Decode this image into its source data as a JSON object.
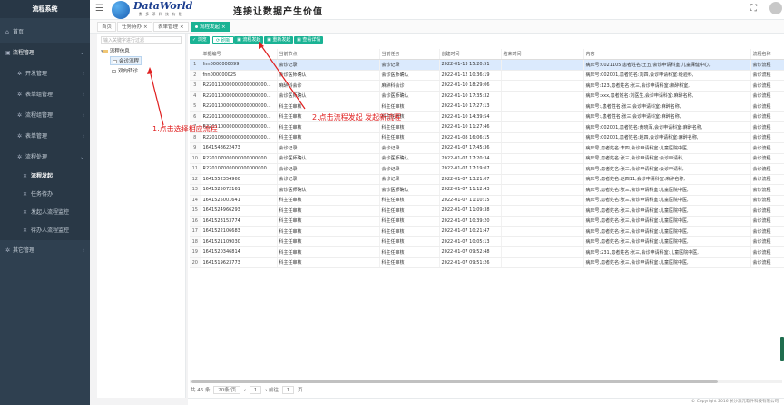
{
  "app": {
    "title": "流程系统"
  },
  "sidebar": {
    "items": [
      {
        "label": "首页",
        "icon": "home-icon"
      },
      {
        "label": "流程管理",
        "icon": "cube-icon",
        "expanded": true
      }
    ],
    "subitems": [
      {
        "label": "开发管理"
      },
      {
        "label": "表单组管理"
      },
      {
        "label": "流程组管理"
      },
      {
        "label": "表单管理"
      },
      {
        "label": "流程处理",
        "expanded": true
      }
    ],
    "leafs": [
      {
        "label": "流程发起",
        "active": true
      },
      {
        "label": "任务待办"
      },
      {
        "label": "发起人流程监控"
      },
      {
        "label": "待办人流程监控"
      }
    ],
    "other": {
      "label": "其它管理"
    }
  },
  "header": {
    "logo_text": "DataWorld",
    "logo_sub": "数 多 浮 科 技 有 限",
    "slogan": "连接让数据产生价值"
  },
  "tabs": [
    {
      "label": "首页",
      "active": false
    },
    {
      "label": "任务待办",
      "active": false,
      "close": "×"
    },
    {
      "label": "表单管理",
      "active": false,
      "close": "×"
    },
    {
      "label": "流程发起",
      "active": true,
      "close": "×"
    }
  ],
  "tree": {
    "search_placeholder": "输入关键字进行过滤",
    "root": "流程信息",
    "children": [
      "会诊流程",
      "双向转诊"
    ]
  },
  "toolbar": {
    "buttons": [
      "浏览",
      "刷新",
      "流程发起",
      "重新发起",
      "查看详情"
    ]
  },
  "table": {
    "columns": [
      "",
      "单据编号",
      "当前节点",
      "当前任务",
      "创建时间",
      "结束时间",
      "内容",
      "流程名称"
    ],
    "rows": [
      [
        "1",
        "fnn0000000099",
        "会诊记录",
        "会诊记录",
        "2022-01-13 15:20:51",
        "",
        "病床号:0021105,患者姓名:王五,会诊申请科室:儿童保健中心,",
        "会诊流程"
      ],
      [
        "2",
        "fnn000000025",
        "会诊医师确认",
        "会诊医师确认",
        "2022-01-12 10:36:19",
        "",
        "病床号:002001,患者姓名:刘四,会诊申请科室:经验科,",
        "会诊流程"
      ],
      [
        "3",
        "R220110000000000000000...",
        "麻醉科会诊",
        "麻醉科会诊",
        "2022-01-10 18:29:06",
        "",
        "病床号:123,患者姓名:张三,会诊申请科室:麻醉科室,",
        "会诊流程"
      ],
      [
        "4",
        "R220110000000000000000...",
        "会诊医师确认",
        "会诊医师确认",
        "2022-01-10 17:35:32",
        "",
        "病床号:xxx,患者姓名:刘医生,会诊申请科室:麻醉名称,",
        "会诊流程"
      ],
      [
        "5",
        "R220110000000000000000...",
        "科主任审核",
        "科主任审核",
        "2022-01-10 17:27:13",
        "",
        "病床号:,患者姓名:张三,会诊申请科室:麻醉名称,",
        "会诊流程"
      ],
      [
        "6",
        "R220110000000000000000...",
        "科主任审核",
        "科主任审核",
        "2022-01-10 14:39:54",
        "",
        "病床号:,患者姓名:张三,会诊申请科室:麻醉名称,",
        "会诊流程"
      ],
      [
        "7",
        "R220110000000000000000...",
        "科主任审核",
        "科主任审核",
        "2022-01-10 11:27:46",
        "",
        "病床号:002001,患者姓名:黄晓军,会诊申请科室:麻醉名称,",
        "会诊流程"
      ],
      [
        "8",
        "R220108000000000000000...",
        "科主任审核",
        "科主任审核",
        "2022-01-08 16:06:15",
        "",
        "病床号:002001,患者姓名:赵四,会诊申请科室:麻醉名称,",
        "会诊流程"
      ],
      [
        "9",
        "1641548622473",
        "会诊记录",
        "会诊记录",
        "2022-01-07 17:45:36",
        "",
        "病床号,患者姓名:李四,会诊申请科室:儿童医院中医,",
        "会诊流程"
      ],
      [
        "10",
        "R220107000000000000000...",
        "会诊医师确认",
        "会诊医师确认",
        "2022-01-07 17:20:34",
        "",
        "病床号,患者姓名:张三,会诊申请科室:会诊申请科,",
        "会诊流程"
      ],
      [
        "11",
        "R220107000000000000000...",
        "会诊记录",
        "会诊记录",
        "2022-01-07 17:19:07",
        "",
        "病床号,患者姓名:张三,会诊申请科室:会诊申请科,",
        "会诊流程"
      ],
      [
        "12",
        "1641552354960",
        "会诊记录",
        "会诊记录",
        "2022-01-07 13:21:07",
        "",
        "病床号,患者姓名:赵四11,会诊申请科室:麻醉名称,",
        "会诊流程"
      ],
      [
        "13",
        "1641525072161",
        "会诊医师确认",
        "会诊医师确认",
        "2022-01-07 11:12:43",
        "",
        "病床号,患者姓名:张三,会诊申请科室:儿童医院中医,",
        "会诊流程"
      ],
      [
        "14",
        "1641525001641",
        "科主任审核",
        "科主任审核",
        "2022-01-07 11:10:15",
        "",
        "病床号,患者姓名:张三,会诊申请科室:儿童医院中医,",
        "会诊流程"
      ],
      [
        "15",
        "1641524966293",
        "科主任审核",
        "科主任审核",
        "2022-01-07 11:09:38",
        "",
        "病床号,患者姓名:张三,会诊申请科室:儿童医院中医,",
        "会诊流程"
      ],
      [
        "16",
        "1641523153774",
        "科主任审核",
        "科主任审核",
        "2022-01-07 10:39:20",
        "",
        "病床号,患者姓名:张三,会诊申请科室:儿童医院中医,",
        "会诊流程"
      ],
      [
        "17",
        "1641522106683",
        "科主任审核",
        "科主任审核",
        "2022-01-07 10:21:47",
        "",
        "病床号,患者姓名:张三,会诊申请科室:儿童医院中医,",
        "会诊流程"
      ],
      [
        "18",
        "1641521109030",
        "科主任审核",
        "科主任审核",
        "2022-01-07 10:05:13",
        "",
        "病床号,患者姓名:张三,会诊申请科室:儿童医院中医,",
        "会诊流程"
      ],
      [
        "19",
        "1641520346814",
        "科主任审核",
        "科主任审核",
        "2022-01-07 09:52:48",
        "",
        "病床号:231,患者姓名:张三,会诊申请科室:儿童医院中医,",
        "会诊流程"
      ],
      [
        "20",
        "1641519623773",
        "科主任审核",
        "科主任审核",
        "2022-01-07 09:51:26",
        "",
        "病床号,患者姓名:张三,会诊申请科室:儿童医院中医,",
        "会诊流程"
      ]
    ]
  },
  "pager": {
    "total": "共 46 条",
    "page_size": "20条/页",
    "prev": "‹",
    "page_label": "前往",
    "page_num": "1",
    "page_unit": "页",
    "next": "›"
  },
  "footer": {
    "copyright": "© Copyright 2016 长沙源元软件科技有限公司"
  },
  "annotations": {
    "step1": "1.点击选择相应流程",
    "step2": "2.点击流程发起 发起新流程"
  },
  "colors": {
    "sidebar": "#2f4050",
    "accent": "#1ab394",
    "annotation": "#e02020"
  }
}
